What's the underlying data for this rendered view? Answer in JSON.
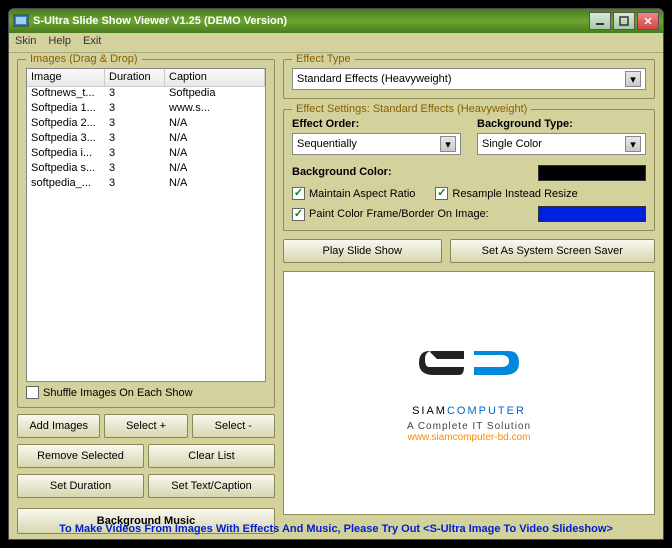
{
  "title": "S-Ultra Slide Show Viewer V1.25 (DEMO Version)",
  "menu": {
    "skin": "Skin",
    "help": "Help",
    "exit": "Exit"
  },
  "images_group": {
    "legend": "Images (Drag & Drop)",
    "headers": {
      "image": "Image",
      "duration": "Duration",
      "caption": "Caption"
    },
    "rows": [
      {
        "image": "Softnews_t...",
        "duration": "3",
        "caption": "Softpedia"
      },
      {
        "image": "Softpedia 1...",
        "duration": "3",
        "caption": "www.s..."
      },
      {
        "image": "Softpedia 2...",
        "duration": "3",
        "caption": "N/A"
      },
      {
        "image": "Softpedia 3...",
        "duration": "3",
        "caption": "N/A"
      },
      {
        "image": "Softpedia i...",
        "duration": "3",
        "caption": "N/A"
      },
      {
        "image": "Softpedia s...",
        "duration": "3",
        "caption": "N/A"
      },
      {
        "image": "softpedia_...",
        "duration": "3",
        "caption": "N/A"
      }
    ],
    "shuffle_label": "Shuffle Images On Each Show"
  },
  "buttons": {
    "add_images": "Add Images",
    "select_plus": "Select +",
    "select_minus": "Select -",
    "remove_selected": "Remove Selected",
    "clear_list": "Clear List",
    "set_duration": "Set Duration",
    "set_caption": "Set Text/Caption",
    "bg_music": "Background Music",
    "play": "Play Slide Show",
    "screensaver": "Set As  System Screen Saver"
  },
  "effect_type": {
    "legend": "Effect Type",
    "value": "Standard Effects (Heavyweight)"
  },
  "effect_settings": {
    "legend_prefix": "Effect Settings: ",
    "legend_value": "Standard Effects (Heavyweight)",
    "order_label": "Effect Order:",
    "order_value": "Sequentially",
    "bg_type_label": "Background Type:",
    "bg_type_value": "Single Color",
    "bg_color_label": "Background Color:",
    "maintain_label": "Maintain Aspect Ratio",
    "resample_label": "Resample Instead Resize",
    "paint_label": "Paint Color Frame/Border On Image:"
  },
  "logo": {
    "brand_prefix": "SIAM",
    "brand_suffix": "COMPUTER",
    "tagline": "A Complete IT Solution",
    "url": "www.siamcomputer-bd.com"
  },
  "footer": "To Make Videos From Images With Effects And Music, Please Try Out <S-Ultra Image To Video Slideshow>"
}
